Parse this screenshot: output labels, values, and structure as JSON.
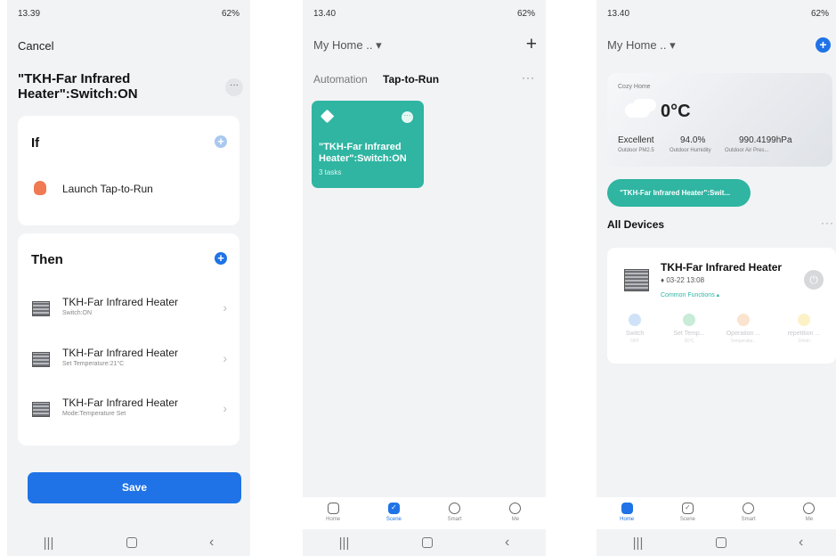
{
  "screen1": {
    "status": {
      "time": "13.39",
      "right": "62%"
    },
    "cancel": "Cancel",
    "title": "\"TKH-Far Infrared Heater\":Switch:ON",
    "more": "···",
    "if_card": {
      "heading": "If",
      "condition": "Launch Tap-to-Run"
    },
    "then_card": {
      "heading": "Then",
      "actions": [
        {
          "title": "TKH-Far Infrared Heater",
          "subtitle": "Switch:ON"
        },
        {
          "title": "TKH-Far Infrared Heater",
          "subtitle": "Set Temperature:21°C"
        },
        {
          "title": "TKH-Far Infrared Heater",
          "subtitle": "Mode:Temperature Set"
        }
      ]
    },
    "save_label": "Save"
  },
  "screen2": {
    "status": {
      "time": "13.40",
      "right": "62%"
    },
    "home_selector": "My Home .. ▾",
    "tabs": {
      "automation": "Automation",
      "tap_to_run": "Tap-to-Run"
    },
    "more": "···",
    "scene_tile": {
      "title": "\"TKH-Far Infrared Heater\":Switch:ON",
      "subtitle": "3 tasks",
      "color": "#2fb5a2"
    },
    "tabbar": [
      {
        "label": "Home",
        "icon": "home-icon"
      },
      {
        "label": "Scene",
        "icon": "scene-icon",
        "selected": true
      },
      {
        "label": "Smart",
        "icon": "smart-icon"
      },
      {
        "label": "Me",
        "icon": "profile-icon"
      }
    ]
  },
  "screen3": {
    "status": {
      "time": "13.40",
      "right": "62%"
    },
    "home_selector": "My Home .. ▾",
    "weather": {
      "location": "Cozy Home",
      "temperature": "0°C",
      "values": [
        "Excellent",
        "94.0%",
        "990.4199hPa"
      ],
      "labels": [
        "Outdoor PM2.5",
        "Outdoor Humidity",
        "Outdoor Air Pres..."
      ]
    },
    "scene_pill": "\"TKH-Far Infrared Heater\":Swit...",
    "all_devices": "All Devices",
    "more": "···",
    "device": {
      "name": "TKH-Far Infrared Heater",
      "time": "03-22 13:08",
      "common_functions": "Common Functions ▴",
      "functions": [
        {
          "label": "Switch",
          "value": "OFF",
          "color": "#cfe2f7"
        },
        {
          "label": "Set Temp...",
          "value": "26°C",
          "color": "#c8ecd7"
        },
        {
          "label": "Operation ...",
          "value": "Temperatur...",
          "color": "#fbe4cf"
        },
        {
          "label": "repetition ...",
          "value": "10min",
          "color": "#fdf1c8"
        }
      ]
    },
    "tabbar": [
      {
        "label": "Home",
        "icon": "home-icon",
        "selected": true
      },
      {
        "label": "Scene",
        "icon": "scene-icon"
      },
      {
        "label": "Smart",
        "icon": "smart-icon"
      },
      {
        "label": "Me",
        "icon": "profile-icon"
      }
    ]
  },
  "accent_blue": "#1f73e6",
  "accent_teal": "#2fb5a2"
}
